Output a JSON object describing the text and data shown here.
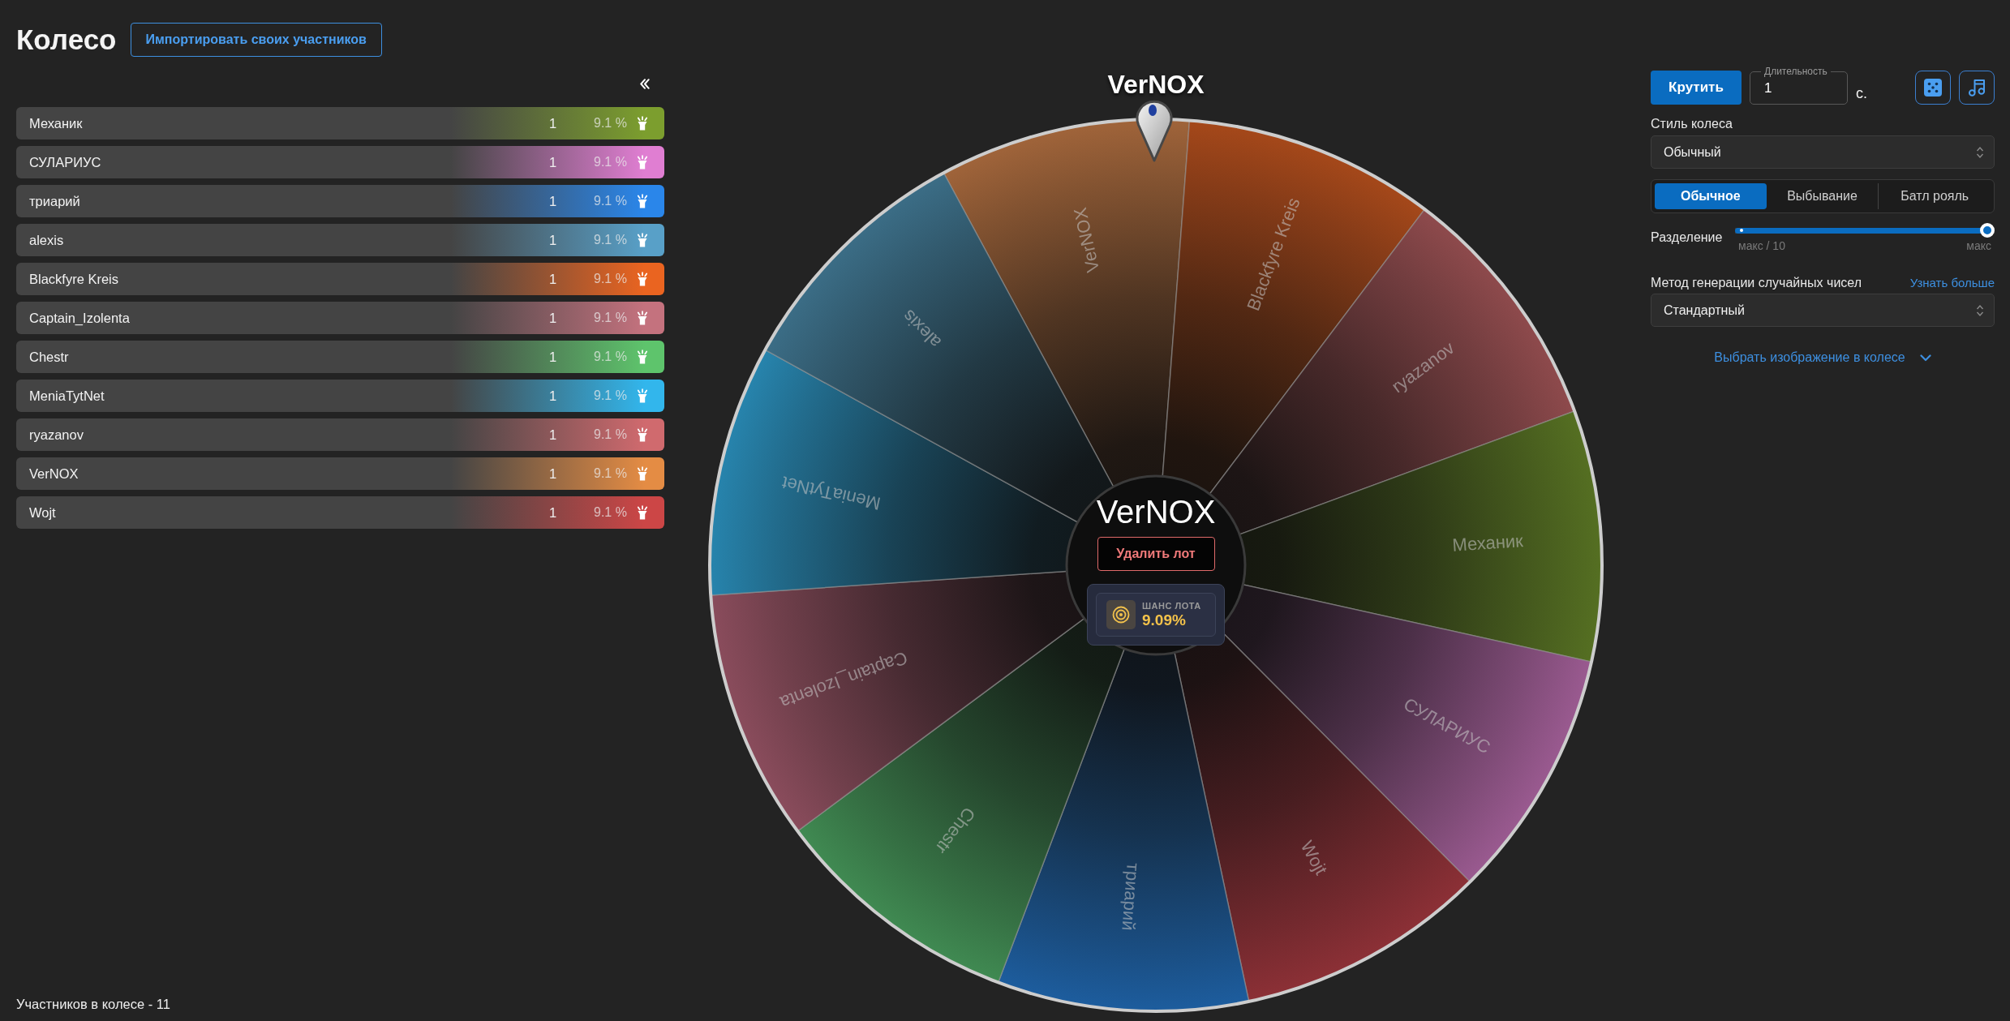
{
  "header": {
    "title": "Колесо",
    "import_button": "Импортировать своих участников"
  },
  "participants": [
    {
      "name": "Механик",
      "count": "1",
      "chance": "9.1 %",
      "color": "#7c9e2e"
    },
    {
      "name": "СУЛАРИУС",
      "count": "1",
      "chance": "9.1 %",
      "color": "#e07ed2"
    },
    {
      "name": "триарий",
      "count": "1",
      "chance": "9.1 %",
      "color": "#2a86ea"
    },
    {
      "name": "alexis",
      "count": "1",
      "chance": "9.1 %",
      "color": "#58a0c8"
    },
    {
      "name": "Blackfyre Kreis",
      "count": "1",
      "chance": "9.1 %",
      "color": "#ea6420"
    },
    {
      "name": "Captain_Izolenta",
      "count": "1",
      "chance": "9.1 %",
      "color": "#c4727e"
    },
    {
      "name": "Chestr",
      "count": "1",
      "chance": "9.1 %",
      "color": "#5ec46c"
    },
    {
      "name": "MeniaTytNet",
      "count": "1",
      "chance": "9.1 %",
      "color": "#32b6ec"
    },
    {
      "name": "ryazanov",
      "count": "1",
      "chance": "9.1 %",
      "color": "#d06a6e"
    },
    {
      "name": "VerNOX",
      "count": "1",
      "chance": "9.1 %",
      "color": "#e48c44"
    },
    {
      "name": "Wojt",
      "count": "1",
      "chance": "9.1 %",
      "color": "#cc4646"
    }
  ],
  "participants_total": "Участников в колесе - 11",
  "wheel": {
    "pointer_label": "VerNOX",
    "segments": [
      {
        "label": "VerNOX",
        "color": "#a0643a"
      },
      {
        "label": "Blackfyre Kreis",
        "color": "#a5481a"
      },
      {
        "label": "ryazanov",
        "color": "#8e4a4c"
      },
      {
        "label": "Механик",
        "color": "#556f22"
      },
      {
        "label": "СУЛАРИУС",
        "color": "#9a5a90"
      },
      {
        "label": "Wojt",
        "color": "#8c3036"
      },
      {
        "label": "триарий",
        "color": "#1d5d9e"
      },
      {
        "label": "Chestr",
        "color": "#408a52"
      },
      {
        "label": "Captain_Izolenta",
        "color": "#8a4c5c"
      },
      {
        "label": "MeniaTytNet",
        "color": "#2784ad"
      },
      {
        "label": "alexis",
        "color": "#3b6d86"
      }
    ],
    "center": {
      "winner": "VerNOX",
      "delete_button": "Удалить лот",
      "chance_label": "ШАНС ЛОТА",
      "chance_value": "9.09%"
    }
  },
  "controls": {
    "spin_button": "Крутить",
    "duration": {
      "label": "Длительность",
      "value": "1",
      "unit": "с."
    },
    "wheel_style": {
      "label": "Стиль колеса",
      "value": "Обычный"
    },
    "modes": [
      {
        "label": "Обычное",
        "selected": true
      },
      {
        "label": "Выбывание",
        "selected": false
      },
      {
        "label": "Батл рояль",
        "selected": false
      }
    ],
    "split": {
      "label": "Разделение",
      "level": 1,
      "min_label": "макс / 10",
      "max_label": "макс"
    },
    "rng": {
      "label": "Метод генерации случайных чисел",
      "link": "Узнать больше",
      "value": "Стандартный"
    },
    "image_picker": "Выбрать изображение в колесе"
  }
}
